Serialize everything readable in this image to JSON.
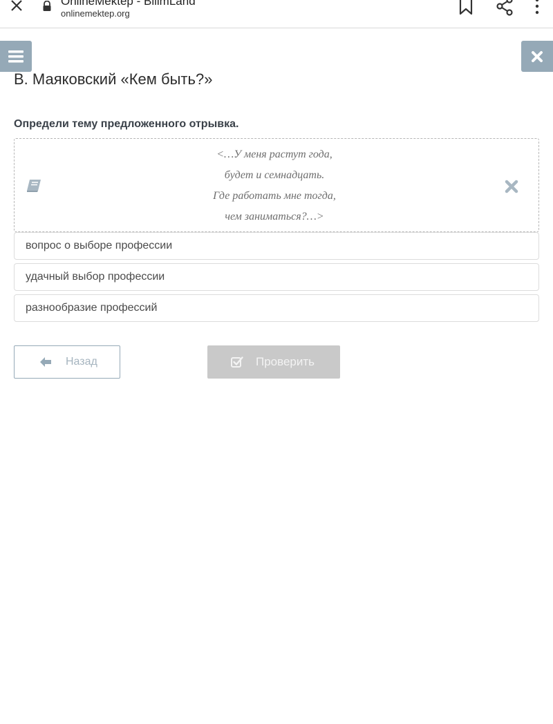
{
  "browser": {
    "title": "OnlineMektep - BilimLand",
    "url": "onlinemektep.org",
    "icons": [
      "close-icon",
      "lock-icon",
      "bookmark-icon",
      "share-icon",
      "more-vert-icon"
    ]
  },
  "page": {
    "title": "В. Маяковский «Кем быть?»"
  },
  "task": {
    "question": "Определи тему предложенного отрывка.",
    "excerpt": [
      "<…У меня растут года,",
      "будет и семнадцать.",
      "Где работать мне тогда,",
      "чем заниматься?…>"
    ],
    "options": [
      "вопрос о выборе профессии",
      "удачный выбор профессии",
      "разнообразие профессий"
    ]
  },
  "buttons": {
    "back_label": "Назад",
    "check_label": "Проверить"
  },
  "colors": {
    "side_button": "#95a9b7",
    "check_button_disabled": "#c9c9c9",
    "title_text": "#2c2c2c"
  }
}
